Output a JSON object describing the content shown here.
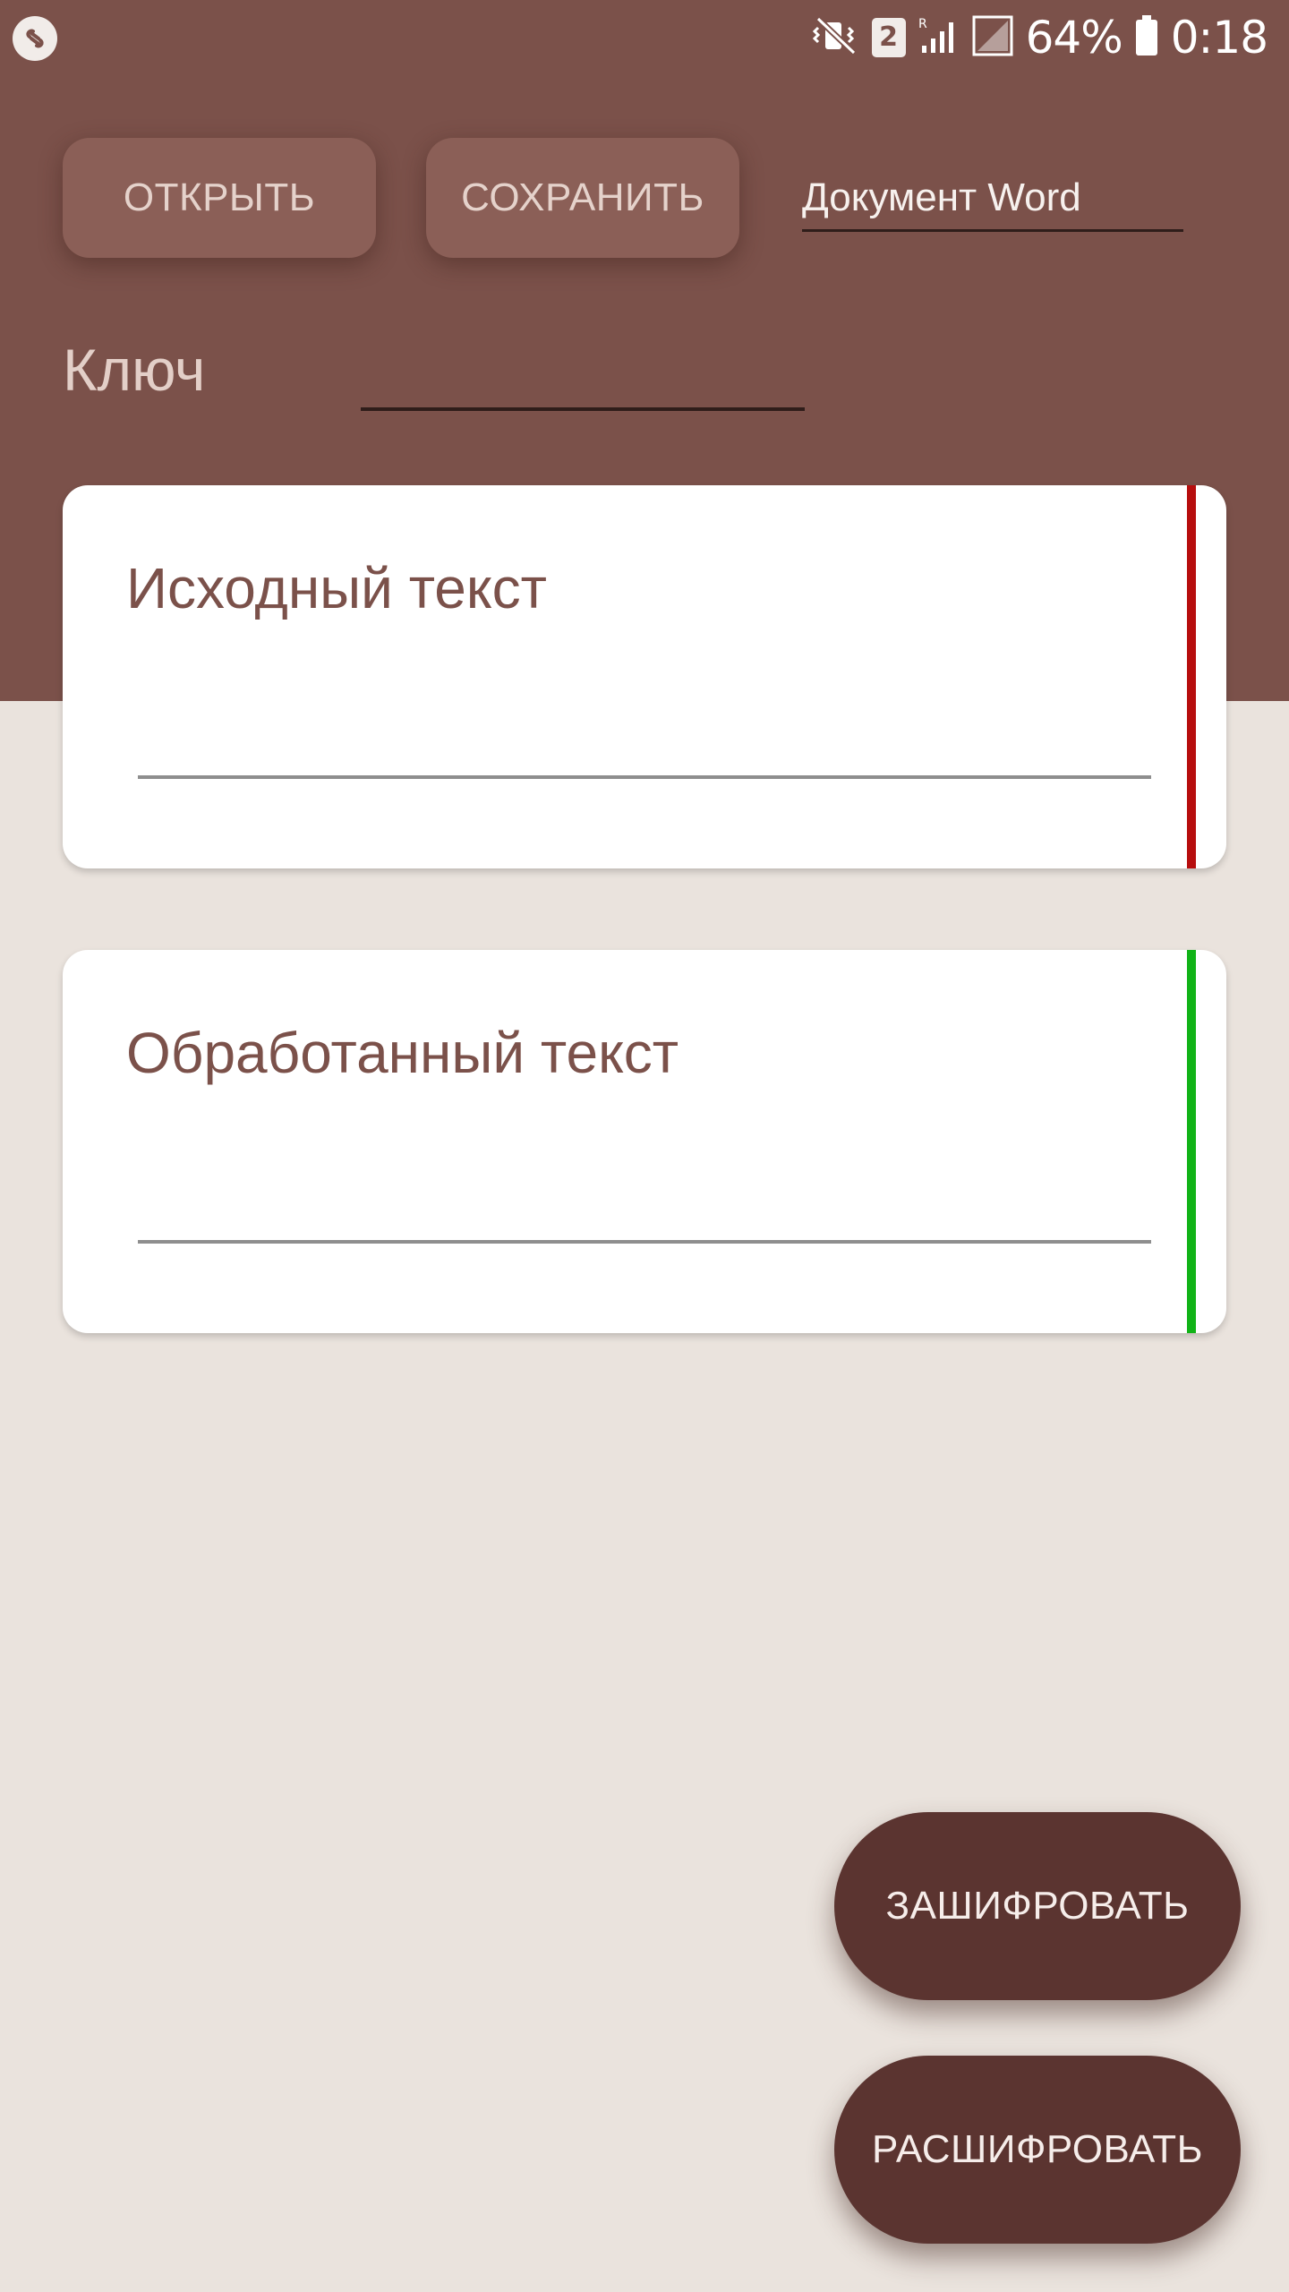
{
  "status_bar": {
    "app_icon": "shazam-icon",
    "icons": [
      "mute-vibrate-icon",
      "sim-2-icon",
      "signal-roaming-icon",
      "signal-icon",
      "battery-icon"
    ],
    "sim_number": "2",
    "battery": "64%",
    "time": "0:18"
  },
  "toolbar": {
    "open_label": "ОТКРЫТЬ",
    "save_label": "СОХРАНИТЬ",
    "format_selected": "Документ Word"
  },
  "key": {
    "label": "Ключ",
    "value": ""
  },
  "source": {
    "title": "Исходный текст",
    "value": ""
  },
  "result": {
    "title": "Обработанный текст",
    "value": ""
  },
  "actions": {
    "encrypt_label": "ЗАШИФРОВАТЬ",
    "decrypt_label": "РАСШИФРОВАТЬ"
  },
  "colors": {
    "primary": "#7B514A",
    "primary_dark": "#5B3430",
    "background": "#EAE3DD",
    "source_accent": "#B70E0E",
    "result_accent": "#11B317"
  }
}
